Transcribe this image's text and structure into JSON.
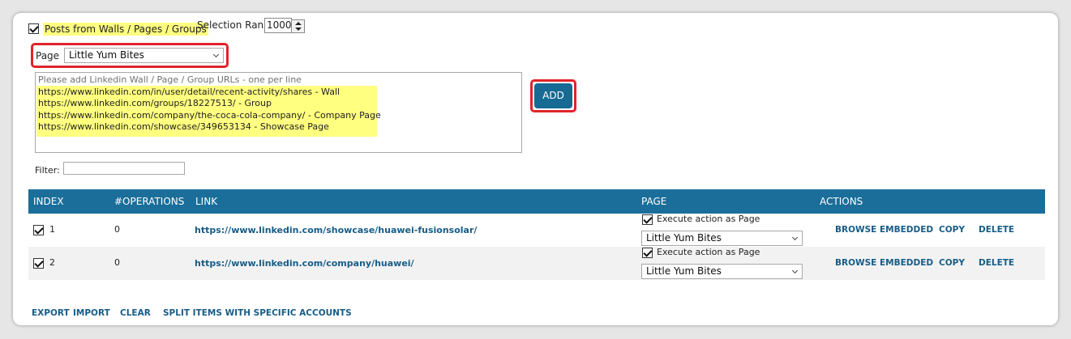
{
  "options": {
    "posts_label": "Posts from Walls / Pages / Groups",
    "selection_rank_label": "Selection Rank",
    "selection_rank_value": "1000",
    "page_label": "Page",
    "page_value": "Little Yum Bites"
  },
  "urls": {
    "placeholder": "Please add Linkedin Wall / Page / Group URLs - one per line",
    "lines": [
      "https://www.linkedin.com/in/user/detail/recent-activity/shares - Wall",
      "https://www.linkedin.com/groups/18227513/ - Group",
      "https://www.linkedin.com/company/the-coca-cola-company/ - Company Page",
      "https://www.linkedin.com/showcase/349653134 - Showcase Page"
    ],
    "add_label": "ADD"
  },
  "filter": {
    "label": "Filter:",
    "value": ""
  },
  "table": {
    "headers": [
      "INDEX",
      "#OPERATIONS",
      "LINK",
      "PAGE",
      "ACTIONS"
    ],
    "rows": [
      {
        "index": "1",
        "operations": "0",
        "link": "https://www.linkedin.com/showcase/huawei-fusionsolar/",
        "execute_label": "Execute action as Page",
        "page": "Little Yum Bites",
        "browse": "BROWSE EMBEDDED",
        "copy": "COPY",
        "delete": "DELETE"
      },
      {
        "index": "2",
        "operations": "0",
        "link": "https://www.linkedin.com/company/huawei/",
        "execute_label": "Execute action as Page",
        "page": "Little Yum Bites",
        "browse": "BROWSE EMBEDDED",
        "copy": "COPY",
        "delete": "DELETE"
      }
    ]
  },
  "footer": {
    "export": "EXPORT",
    "import": "IMPORT",
    "clear": "CLEAR",
    "split": "SPLIT ITEMS WITH SPECIFIC ACCOUNTS"
  },
  "colors": {
    "header_bg": "#1a6e99",
    "accent": "#176a93",
    "highlight": "#ffff80",
    "callout": "#e0242b",
    "row_alt": "#f2f2f2"
  }
}
